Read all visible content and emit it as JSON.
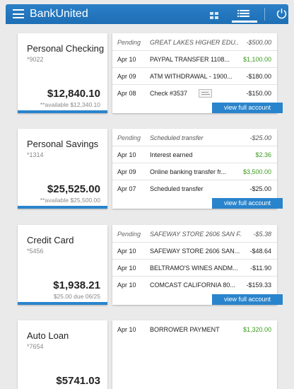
{
  "app": {
    "title": "BankUnited"
  },
  "accounts": [
    {
      "name": "Personal Checking",
      "number": "*9022",
      "balance": "$12,840.10",
      "available": "**available $12,340.10",
      "view_link": "view full account",
      "transactions": [
        {
          "date": "Pending",
          "description": "GREAT LAKES HIGHER EDU...",
          "amount": "-$500.00",
          "pending": true
        },
        {
          "date": "Apr 10",
          "description": "PAYPAL TRANSFER 1108...",
          "amount": "$1,100.00",
          "positive": true
        },
        {
          "date": "Apr 09",
          "description": "ATM WITHDRAWAL - 1900...",
          "amount": "-$180.00"
        },
        {
          "date": "Apr 08",
          "description": "Check #3537",
          "amount": "-$150.00",
          "has_check_image": true
        }
      ]
    },
    {
      "name": "Personal Savings",
      "number": "*1314",
      "balance": "$25,525.00",
      "available": "**available $25,500.00",
      "view_link": "view full account",
      "transactions": [
        {
          "date": "Pending",
          "description": "Scheduled transfer",
          "amount": "-$25.00",
          "pending": true
        },
        {
          "date": "Apr 10",
          "description": "Interest earned",
          "amount": "$2.36",
          "positive": true
        },
        {
          "date": "Apr 09",
          "description": "Online banking transfer fr...",
          "amount": "$3,500.00",
          "positive": true
        },
        {
          "date": "Apr 07",
          "description": "Scheduled transfer",
          "amount": "-$25.00"
        }
      ]
    },
    {
      "name": "Credit Card",
      "number": "*5456",
      "balance": "$1,938.21",
      "available": "$25.00 due 06/25",
      "view_link": "view full account",
      "transactions": [
        {
          "date": "Pending",
          "description": "SAFEWAY STORE 2606 SAN F...",
          "amount": "-$5.38",
          "pending": true
        },
        {
          "date": "Apr 10",
          "description": "SAFEWAY STORE 2606 SAN...",
          "amount": "-$48.64"
        },
        {
          "date": "Apr 10",
          "description": "BELTRAMO'S WINES ANDM...",
          "amount": "-$11.90"
        },
        {
          "date": "Apr 10",
          "description": "COMCAST CALIFORNIA 80...",
          "amount": "-$159.33"
        }
      ]
    },
    {
      "name": "Auto Loan",
      "number": "*7654",
      "balance": "$5741.03",
      "available": "",
      "view_link": "",
      "transactions": [
        {
          "date": "Apr 10",
          "description": "BORROWER PAYMENT",
          "amount": "$1,320.00",
          "positive": true
        }
      ]
    }
  ],
  "colors": {
    "accent": "#2a84cc",
    "positive": "#3a9a1d",
    "appbar": "#2277bd"
  }
}
